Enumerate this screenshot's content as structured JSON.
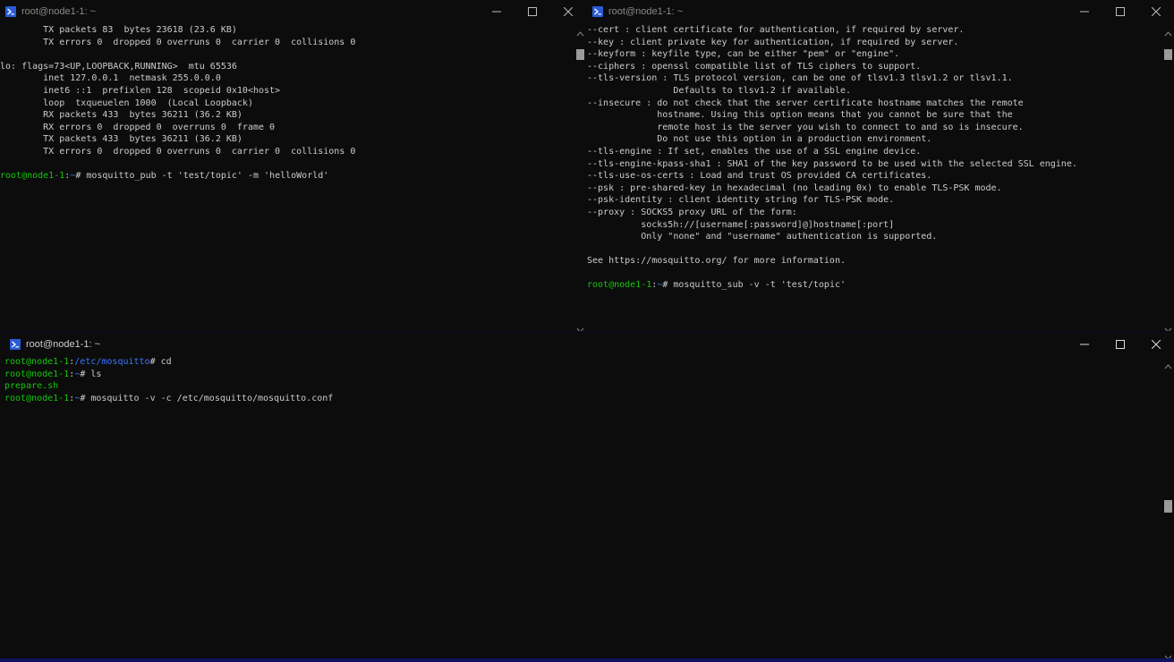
{
  "windows": {
    "top_left": {
      "title": "root@node1-1: ~",
      "lines": [
        {
          "segs": [
            {
              "t": "        TX packets 83  bytes 23618 (23.6 KB)"
            }
          ]
        },
        {
          "segs": [
            {
              "t": "        TX errors 0  dropped 0 overruns 0  carrier 0  collisions 0"
            }
          ]
        },
        {
          "segs": [
            {
              "t": ""
            }
          ]
        },
        {
          "segs": [
            {
              "t": "lo: flags=73<UP,LOOPBACK,RUNNING>  mtu 65536"
            }
          ]
        },
        {
          "segs": [
            {
              "t": "        inet 127.0.0.1  netmask 255.0.0.0"
            }
          ]
        },
        {
          "segs": [
            {
              "t": "        inet6 ::1  prefixlen 128  scopeid 0x10<host>"
            }
          ]
        },
        {
          "segs": [
            {
              "t": "        loop  txqueuelen 1000  (Local Loopback)"
            }
          ]
        },
        {
          "segs": [
            {
              "t": "        RX packets 433  bytes 36211 (36.2 KB)"
            }
          ]
        },
        {
          "segs": [
            {
              "t": "        RX errors 0  dropped 0  overruns 0  frame 0"
            }
          ]
        },
        {
          "segs": [
            {
              "t": "        TX packets 433  bytes 36211 (36.2 KB)"
            }
          ]
        },
        {
          "segs": [
            {
              "t": "        TX errors 0  dropped 0 overruns 0  carrier 0  collisions 0"
            }
          ]
        },
        {
          "segs": [
            {
              "t": ""
            }
          ]
        },
        {
          "segs": [
            {
              "t": "root@node1-1",
              "c": "g"
            },
            {
              "t": ":"
            },
            {
              "t": "~",
              "c": "b"
            },
            {
              "t": "# mosquitto_pub -t 'test/topic' -m 'helloWorld'"
            }
          ]
        }
      ]
    },
    "top_right": {
      "title": "root@node1-1: ~",
      "lines": [
        {
          "segs": [
            {
              "t": "--cert : client certificate for authentication, if required by server."
            }
          ]
        },
        {
          "segs": [
            {
              "t": "--key : client private key for authentication, if required by server."
            }
          ]
        },
        {
          "segs": [
            {
              "t": "--keyform : keyfile type, can be either \"pem\" or \"engine\"."
            }
          ]
        },
        {
          "segs": [
            {
              "t": "--ciphers : openssl compatible list of TLS ciphers to support."
            }
          ]
        },
        {
          "segs": [
            {
              "t": "--tls-version : TLS protocol version, can be one of tlsv1.3 tlsv1.2 or tlsv1.1."
            }
          ]
        },
        {
          "segs": [
            {
              "t": "                Defaults to tlsv1.2 if available."
            }
          ]
        },
        {
          "segs": [
            {
              "t": "--insecure : do not check that the server certificate hostname matches the remote"
            }
          ]
        },
        {
          "segs": [
            {
              "t": "             hostname. Using this option means that you cannot be sure that the"
            }
          ]
        },
        {
          "segs": [
            {
              "t": "             remote host is the server you wish to connect to and so is insecure."
            }
          ]
        },
        {
          "segs": [
            {
              "t": "             Do not use this option in a production environment."
            }
          ]
        },
        {
          "segs": [
            {
              "t": "--tls-engine : If set, enables the use of a SSL engine device."
            }
          ]
        },
        {
          "segs": [
            {
              "t": "--tls-engine-kpass-sha1 : SHA1 of the key password to be used with the selected SSL engine."
            }
          ]
        },
        {
          "segs": [
            {
              "t": "--tls-use-os-certs : Load and trust OS provided CA certificates."
            }
          ]
        },
        {
          "segs": [
            {
              "t": "--psk : pre-shared-key in hexadecimal (no leading 0x) to enable TLS-PSK mode."
            }
          ]
        },
        {
          "segs": [
            {
              "t": "--psk-identity : client identity string for TLS-PSK mode."
            }
          ]
        },
        {
          "segs": [
            {
              "t": "--proxy : SOCKS5 proxy URL of the form:"
            }
          ]
        },
        {
          "segs": [
            {
              "t": "          socks5h://[username[:password]@]hostname[:port]"
            }
          ]
        },
        {
          "segs": [
            {
              "t": "          Only \"none\" and \"username\" authentication is supported."
            }
          ]
        },
        {
          "segs": [
            {
              "t": ""
            }
          ]
        },
        {
          "segs": [
            {
              "t": "See https://mosquitto.org/ for more information."
            }
          ]
        },
        {
          "segs": [
            {
              "t": ""
            }
          ]
        },
        {
          "segs": [
            {
              "t": "root@node1-1",
              "c": "g"
            },
            {
              "t": ":"
            },
            {
              "t": "~",
              "c": "b"
            },
            {
              "t": "# mosquitto_sub -v -t 'test/topic'"
            }
          ]
        }
      ]
    },
    "bottom": {
      "title": "root@node1-1: ~",
      "lines": [
        {
          "segs": [
            {
              "t": "root@node1-1",
              "c": "g"
            },
            {
              "t": ":"
            },
            {
              "t": "/etc/mosquitto",
              "c": "b"
            },
            {
              "t": "# cd"
            }
          ]
        },
        {
          "segs": [
            {
              "t": "root@node1-1",
              "c": "g"
            },
            {
              "t": ":"
            },
            {
              "t": "~",
              "c": "b"
            },
            {
              "t": "# ls"
            }
          ]
        },
        {
          "segs": [
            {
              "t": "prepare.sh",
              "c": "g"
            }
          ]
        },
        {
          "segs": [
            {
              "t": "root@node1-1",
              "c": "g"
            },
            {
              "t": ":"
            },
            {
              "t": "~",
              "c": "b"
            },
            {
              "t": "# mosquitto -v -c /etc/mosquitto/mosquitto.conf"
            }
          ]
        }
      ]
    }
  },
  "colors": {
    "terminal_bg": "#0c0c0c",
    "text": "#cccccc",
    "prompt_user": "#16c60c",
    "prompt_path": "#3b78ff",
    "accent": "#4a4ae0"
  },
  "icons": [
    "powershell-icon",
    "minimize-icon",
    "maximize-icon",
    "close-icon",
    "scroll-up-icon",
    "scroll-down-icon"
  ]
}
